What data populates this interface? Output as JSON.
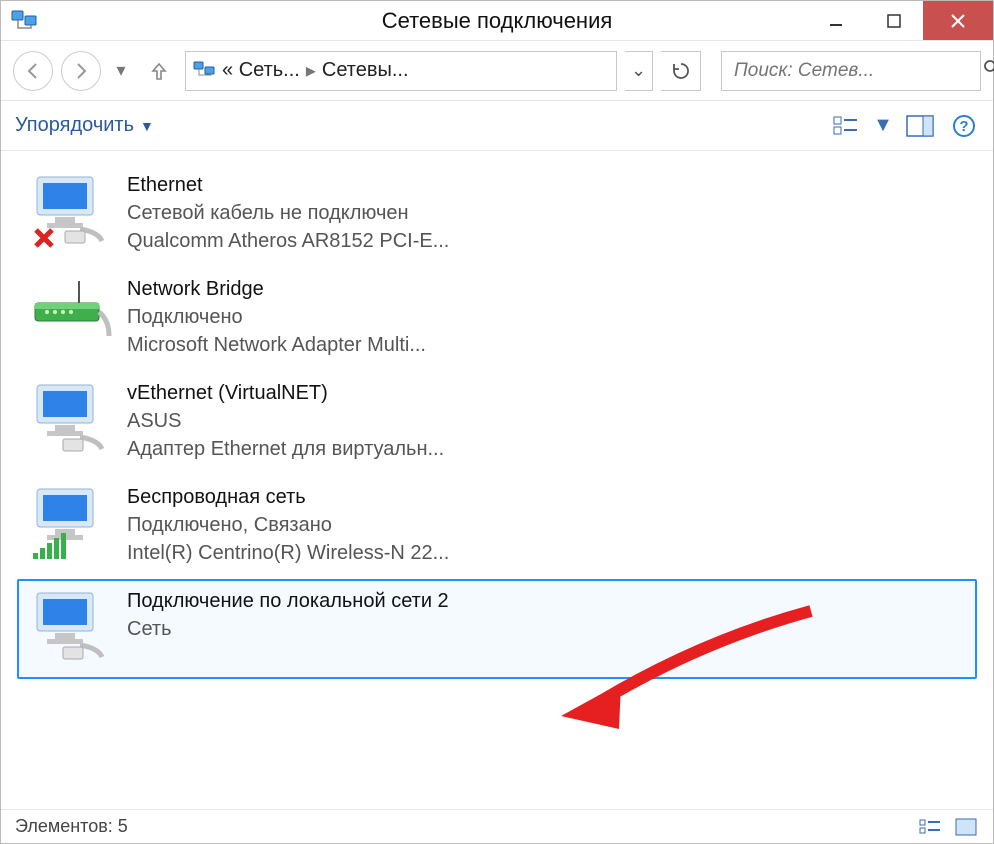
{
  "window": {
    "title": "Сетевые подключения"
  },
  "nav": {
    "crumb1": "«",
    "crumb2": "Сеть...",
    "crumb3": "Сетевы...",
    "search_placeholder": "Поиск: Сетев..."
  },
  "toolbar": {
    "organize_label": "Упорядочить"
  },
  "connections": [
    {
      "name": "Ethernet",
      "status": "Сетевой кабель не подключен",
      "device": "Qualcomm Atheros AR8152 PCI-E...",
      "kind": "disconnected"
    },
    {
      "name": "Network Bridge",
      "status": "Подключено",
      "device": "Microsoft Network Adapter Multi...",
      "kind": "bridge"
    },
    {
      "name": "vEthernet (VirtualNET)",
      "status": "ASUS",
      "device": "Адаптер Ethernet для виртуальн...",
      "kind": "ethernet"
    },
    {
      "name": "Беспроводная сеть",
      "status": "Подключено, Связано",
      "device": "Intel(R) Centrino(R) Wireless-N 22...",
      "kind": "wifi"
    },
    {
      "name": "Подключение по локальной сети 2",
      "status": "",
      "device": "Сеть",
      "kind": "ethernet"
    }
  ],
  "status": {
    "label": "Элементов: 5"
  }
}
